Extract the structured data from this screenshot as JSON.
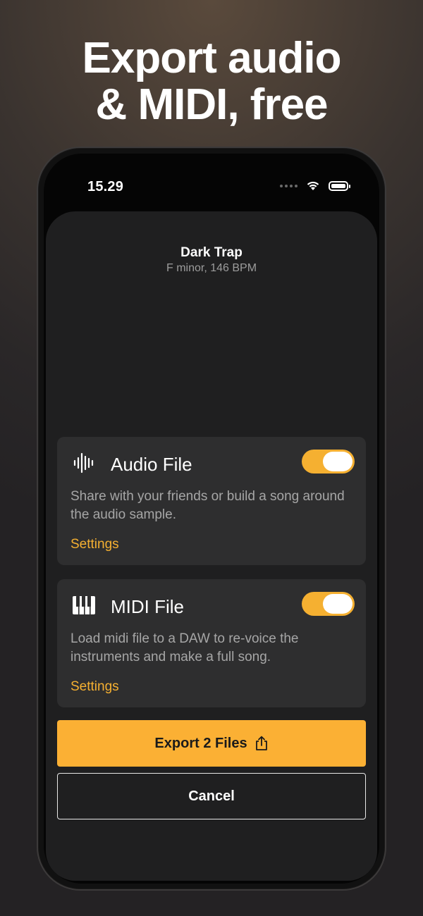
{
  "headline": {
    "line1": "Export audio",
    "line2": "& MIDI, free"
  },
  "status_bar": {
    "time": "15.29",
    "icons": [
      "signal-dots-icon",
      "wifi-icon",
      "battery-icon"
    ]
  },
  "track": {
    "title": "Dark Trap",
    "subtitle": "F minor, 146 BPM"
  },
  "options": [
    {
      "icon": "waveform-icon",
      "title": "Audio File",
      "description": "Share with your friends or build a song around the audio sample.",
      "settings_label": "Settings",
      "enabled": true
    },
    {
      "icon": "piano-keys-icon",
      "title": "MIDI File",
      "description": "Load midi file to a DAW to re-voice the instruments and make a full song.",
      "settings_label": "Settings",
      "enabled": true
    }
  ],
  "actions": {
    "export_label": "Export 2 Files",
    "export_icon": "share-icon",
    "cancel_label": "Cancel"
  },
  "colors": {
    "accent": "#f5b031",
    "sheet": "#1f1f20",
    "card": "#2e2e2f"
  }
}
